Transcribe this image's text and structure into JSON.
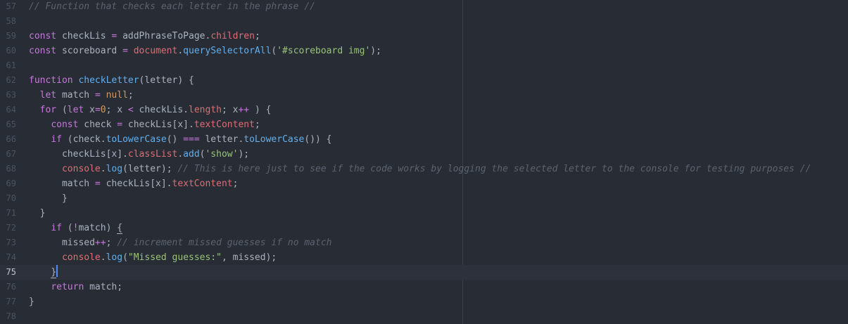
{
  "editor": {
    "active_line": "75",
    "lines": [
      {
        "num": "57",
        "tokens": [
          {
            "t": "cm",
            "v": "// Function that checks each letter in the phrase //"
          }
        ]
      },
      {
        "num": "58",
        "tokens": []
      },
      {
        "num": "59",
        "tokens": [
          {
            "t": "kw",
            "v": "const"
          },
          {
            "t": "pl",
            "v": " checkLis "
          },
          {
            "t": "op",
            "v": "="
          },
          {
            "t": "pl",
            "v": " addPhraseToPage."
          },
          {
            "t": "prop",
            "v": "children"
          },
          {
            "t": "pl",
            "v": ";"
          }
        ]
      },
      {
        "num": "60",
        "tokens": [
          {
            "t": "kw",
            "v": "const"
          },
          {
            "t": "pl",
            "v": " scoreboard "
          },
          {
            "t": "op",
            "v": "="
          },
          {
            "t": "pl",
            "v": " "
          },
          {
            "t": "prop",
            "v": "document"
          },
          {
            "t": "pl",
            "v": "."
          },
          {
            "t": "fn",
            "v": "querySelectorAll"
          },
          {
            "t": "pl",
            "v": "("
          },
          {
            "t": "str",
            "v": "'#scoreboard img'"
          },
          {
            "t": "pl",
            "v": ");"
          }
        ]
      },
      {
        "num": "61",
        "tokens": []
      },
      {
        "num": "62",
        "tokens": [
          {
            "t": "kw",
            "v": "function"
          },
          {
            "t": "pl",
            "v": " "
          },
          {
            "t": "fn",
            "v": "checkLetter"
          },
          {
            "t": "pl",
            "v": "(letter) {"
          }
        ]
      },
      {
        "num": "63",
        "tokens": [
          {
            "t": "pl",
            "v": "  "
          },
          {
            "t": "kw",
            "v": "let"
          },
          {
            "t": "pl",
            "v": " match "
          },
          {
            "t": "op",
            "v": "="
          },
          {
            "t": "pl",
            "v": " "
          },
          {
            "t": "num",
            "v": "null"
          },
          {
            "t": "pl",
            "v": ";"
          }
        ]
      },
      {
        "num": "64",
        "tokens": [
          {
            "t": "pl",
            "v": "  "
          },
          {
            "t": "kw",
            "v": "for"
          },
          {
            "t": "pl",
            "v": " ("
          },
          {
            "t": "kw",
            "v": "let"
          },
          {
            "t": "pl",
            "v": " x"
          },
          {
            "t": "op",
            "v": "="
          },
          {
            "t": "num",
            "v": "0"
          },
          {
            "t": "pl",
            "v": "; x "
          },
          {
            "t": "op",
            "v": "<"
          },
          {
            "t": "pl",
            "v": " checkLis."
          },
          {
            "t": "prop",
            "v": "length"
          },
          {
            "t": "pl",
            "v": "; x"
          },
          {
            "t": "op",
            "v": "++"
          },
          {
            "t": "pl",
            "v": " ) {"
          }
        ]
      },
      {
        "num": "65",
        "tokens": [
          {
            "t": "pl",
            "v": "    "
          },
          {
            "t": "kw",
            "v": "const"
          },
          {
            "t": "pl",
            "v": " check "
          },
          {
            "t": "op",
            "v": "="
          },
          {
            "t": "pl",
            "v": " checkLis[x]."
          },
          {
            "t": "prop",
            "v": "textContent"
          },
          {
            "t": "pl",
            "v": ";"
          }
        ]
      },
      {
        "num": "66",
        "tokens": [
          {
            "t": "pl",
            "v": "    "
          },
          {
            "t": "kw",
            "v": "if"
          },
          {
            "t": "pl",
            "v": " (check."
          },
          {
            "t": "fn",
            "v": "toLowerCase"
          },
          {
            "t": "pl",
            "v": "() "
          },
          {
            "t": "op",
            "v": "==="
          },
          {
            "t": "pl",
            "v": " letter."
          },
          {
            "t": "fn",
            "v": "toLowerCase"
          },
          {
            "t": "pl",
            "v": "()) {"
          }
        ]
      },
      {
        "num": "67",
        "tokens": [
          {
            "t": "pl",
            "v": "      checkLis[x]."
          },
          {
            "t": "prop",
            "v": "classList"
          },
          {
            "t": "pl",
            "v": "."
          },
          {
            "t": "fn",
            "v": "add"
          },
          {
            "t": "pl",
            "v": "("
          },
          {
            "t": "str",
            "v": "'show'"
          },
          {
            "t": "pl",
            "v": ");"
          }
        ]
      },
      {
        "num": "68",
        "tokens": [
          {
            "t": "pl",
            "v": "      "
          },
          {
            "t": "prop",
            "v": "console"
          },
          {
            "t": "pl",
            "v": "."
          },
          {
            "t": "fn",
            "v": "log"
          },
          {
            "t": "pl",
            "v": "(letter); "
          },
          {
            "t": "cm",
            "v": "// This is here just to see if the code works by logging the selected letter to the console for testing purposes //"
          }
        ]
      },
      {
        "num": "69",
        "tokens": [
          {
            "t": "pl",
            "v": "      match "
          },
          {
            "t": "op",
            "v": "="
          },
          {
            "t": "pl",
            "v": " checkLis[x]."
          },
          {
            "t": "prop",
            "v": "textContent"
          },
          {
            "t": "pl",
            "v": ";"
          }
        ]
      },
      {
        "num": "70",
        "tokens": [
          {
            "t": "pl",
            "v": "      }"
          }
        ]
      },
      {
        "num": "71",
        "tokens": [
          {
            "t": "pl",
            "v": "  }"
          }
        ]
      },
      {
        "num": "72",
        "tokens": [
          {
            "t": "pl",
            "v": "    "
          },
          {
            "t": "kw",
            "v": "if"
          },
          {
            "t": "pl",
            "v": " ("
          },
          {
            "t": "op",
            "v": "!"
          },
          {
            "t": "pl",
            "v": "match) "
          },
          {
            "t": "pl bracket-match",
            "v": "{"
          }
        ]
      },
      {
        "num": "73",
        "tokens": [
          {
            "t": "pl",
            "v": "      missed"
          },
          {
            "t": "op",
            "v": "++"
          },
          {
            "t": "pl",
            "v": "; "
          },
          {
            "t": "cm",
            "v": "// increment missed guesses if no match"
          }
        ]
      },
      {
        "num": "74",
        "tokens": [
          {
            "t": "pl",
            "v": "      "
          },
          {
            "t": "prop",
            "v": "console"
          },
          {
            "t": "pl",
            "v": "."
          },
          {
            "t": "fn",
            "v": "log"
          },
          {
            "t": "pl",
            "v": "("
          },
          {
            "t": "str",
            "v": "\"Missed guesses:\""
          },
          {
            "t": "pl",
            "v": ", missed);"
          }
        ]
      },
      {
        "num": "75",
        "tokens": [
          {
            "t": "pl",
            "v": "    "
          },
          {
            "t": "pl bracket-match",
            "v": "}"
          }
        ],
        "cursor": true
      },
      {
        "num": "76",
        "tokens": [
          {
            "t": "pl",
            "v": "    "
          },
          {
            "t": "kw",
            "v": "return"
          },
          {
            "t": "pl",
            "v": " match;"
          }
        ]
      },
      {
        "num": "77",
        "tokens": [
          {
            "t": "pl",
            "v": "}"
          }
        ]
      },
      {
        "num": "78",
        "tokens": []
      }
    ]
  },
  "colors": {
    "background": "#282c34",
    "keyword": "#c678dd",
    "function": "#61afef",
    "property": "#e06c75",
    "string": "#98c379",
    "number": "#d19a66",
    "comment": "#5c6370",
    "plain": "#abb2bf",
    "cursor": "#528bff"
  }
}
